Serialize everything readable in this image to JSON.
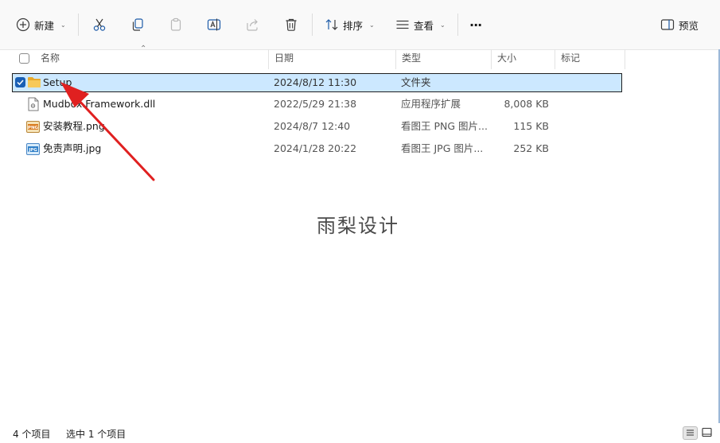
{
  "toolbar": {
    "new_label": "新建",
    "sort_label": "排序",
    "view_label": "查看",
    "more_label": "···",
    "preview_label": "预览"
  },
  "columns": {
    "name": "名称",
    "date": "日期",
    "type": "类型",
    "size": "大小",
    "tags": "标记"
  },
  "files": [
    {
      "name": "Setup",
      "date": "2024/8/12 11:30",
      "type": "文件夹",
      "size": "",
      "icon": "folder-icon",
      "selected": true
    },
    {
      "name": "Mudbox.Framework.dll",
      "date": "2022/5/29 21:38",
      "type": "应用程序扩展",
      "size": "8,008 KB",
      "icon": "dll-file-icon",
      "selected": false
    },
    {
      "name": "安装教程.png",
      "date": "2024/8/7 12:40",
      "type": "看图王 PNG 图片...",
      "size": "115 KB",
      "icon": "png-file-icon",
      "selected": false
    },
    {
      "name": "免责声明.jpg",
      "date": "2024/1/28 20:22",
      "type": "看图王 JPG 图片...",
      "size": "252 KB",
      "icon": "jpg-file-icon",
      "selected": false
    }
  ],
  "watermark": "雨梨设计",
  "status": {
    "item_count": "4 个项目",
    "selected_count": "选中 1 个项目"
  },
  "colors": {
    "selection": "#cce8ff",
    "folder": "#f3c04a",
    "checkbox": "#1a5fb4",
    "arrow": "#e02020"
  }
}
